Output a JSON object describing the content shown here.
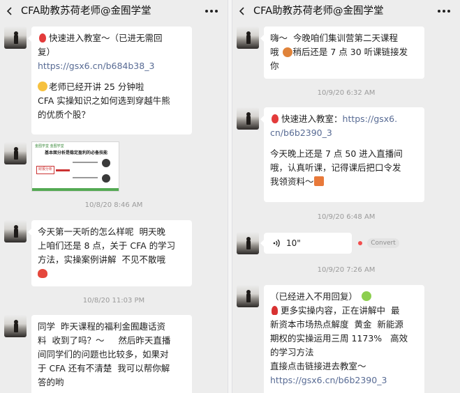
{
  "left": {
    "title": "CFA助教苏荷老师@金囿学堂",
    "messages": {
      "m1_line1": "快速进入教室～（已进无需回",
      "m1_line2": "复）",
      "m1_link": "https://gsx6.cn/b684b38_3",
      "m1_line3": "老师已经开讲 25 分钟啦",
      "m1_line4": "CFA 实操知识之如何选到穿越牛熊",
      "m1_line5": "的优质个股？",
      "thumb_head": "金囿学堂 金囿学堂",
      "thumb_title": "基本面分析是稳定盈利的必备技能",
      "thumb_label": "财报分析",
      "ts1": "10/8/20 8:46 AM",
      "m2_line1": "今天第一天听的怎么样呢  明天晚",
      "m2_line2": "上咱们还是 8 点，关于 CFA 的学习",
      "m2_line3": "方法，实操案例讲解  不见不散哦",
      "ts2": "10/8/20 11:03 PM",
      "m3_line1": "同学  昨天课程的福利金囿趣话资",
      "m3_line2": "料  收到了吗？～     然后昨天直播",
      "m3_line3": "间同学们的问题也比较多，如果对",
      "m3_line4": "于 CFA 还有不清楚  我可以帮你解",
      "m3_line5": "答的哟"
    }
  },
  "right": {
    "title": "CFA助教苏荷老师@金囿学堂",
    "messages": {
      "r1_line1": "嗨～  今晚咱们集训营第二天课程",
      "r1_line2": "哦     稍后还是 7 点 30 听课链接发",
      "r1_line3": "你",
      "ts1": "10/9/20 6:32 AM",
      "r2_line1a": "快速进入教室：",
      "r2_line1b": "https://gsx6.",
      "r2_line2": "cn/b6b2390_3",
      "r2_line3": "今天晚上还是 7 点 50 进入直播间",
      "r2_line4": "哦，认真听课，记得课后把口令发",
      "r2_line5": "我领资料～",
      "ts2": "10/9/20 6:48 AM",
      "voice_duration": "10\"",
      "convert_label": "Convert",
      "ts3": "10/9/20 7:26 AM",
      "r4_line1": "（已经进入不用回复）",
      "r4_line2": "更多实操内容，正在讲解中  最",
      "r4_line3": "新资本市场热点解度  黄金  新能源",
      "r4_line4": "期权的实操运用三周 1173%   高效",
      "r4_line5": "的学习方法",
      "r4_line6": "直接点击链接进去教室～",
      "r4_link": "https://gsx6.cn/b6b2390_3"
    }
  },
  "colors": {
    "background": "#ededed",
    "bubble": "#ffffff",
    "link": "#586b94",
    "timestamp": "#9a9a9a",
    "unread_dot": "#f24e4e"
  },
  "icons": {
    "back": "chevron-left-icon",
    "more": "more-dots-icon",
    "voice": "voice-wave-icon"
  }
}
